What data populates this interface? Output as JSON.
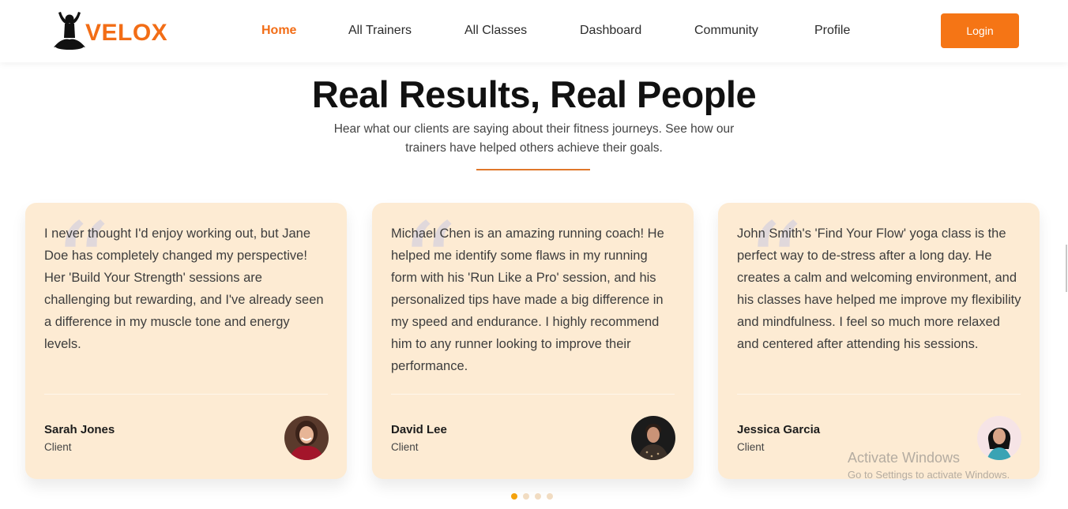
{
  "brand": {
    "name": "VELOX",
    "logo_icon": "meditation-figure-icon",
    "accent": "#f26d16"
  },
  "nav": {
    "items": [
      {
        "label": "Home",
        "active": true
      },
      {
        "label": "All Trainers",
        "active": false
      },
      {
        "label": "All Classes",
        "active": false
      },
      {
        "label": "Dashboard",
        "active": false
      },
      {
        "label": "Community",
        "active": false
      },
      {
        "label": "Profile",
        "active": false
      }
    ],
    "login_label": "Login"
  },
  "section": {
    "title": "Real Results, Real People",
    "subtitle": "Hear what our clients are saying about their fitness journeys. See how our trainers have helped others achieve their goals."
  },
  "testimonials": [
    {
      "text": "I never thought I'd enjoy working out, but Jane Doe has completely changed my perspective! Her 'Build Your Strength' sessions are challenging but rewarding, and I've already seen a difference in my muscle tone and energy levels.",
      "name": "Sarah Jones",
      "role": "Client"
    },
    {
      "text": "Michael Chen is an amazing running coach! He helped me identify some flaws in my running form with his 'Run Like a Pro' session, and his personalized tips have made a big difference in my speed and endurance. I highly recommend him to any runner looking to improve their performance.",
      "name": "David Lee",
      "role": "Client"
    },
    {
      "text": "John Smith's 'Find Your Flow' yoga class is the perfect way to de-stress after a long day. He creates a calm and welcoming environment, and his classes have helped me improve my flexibility and mindfulness. I feel so much more relaxed and centered after attending his sessions.",
      "name": "Jessica Garcia",
      "role": "Client"
    }
  ],
  "carousel": {
    "pages": 4,
    "active_page": 1
  },
  "watermark": {
    "title": "Activate Windows",
    "subtitle": "Go to Settings to activate Windows."
  },
  "colors": {
    "card_bg": "#fdebd3",
    "dot_active": "#f4a20d",
    "dot_inactive": "#f1dcc2",
    "button": "#f57515"
  }
}
